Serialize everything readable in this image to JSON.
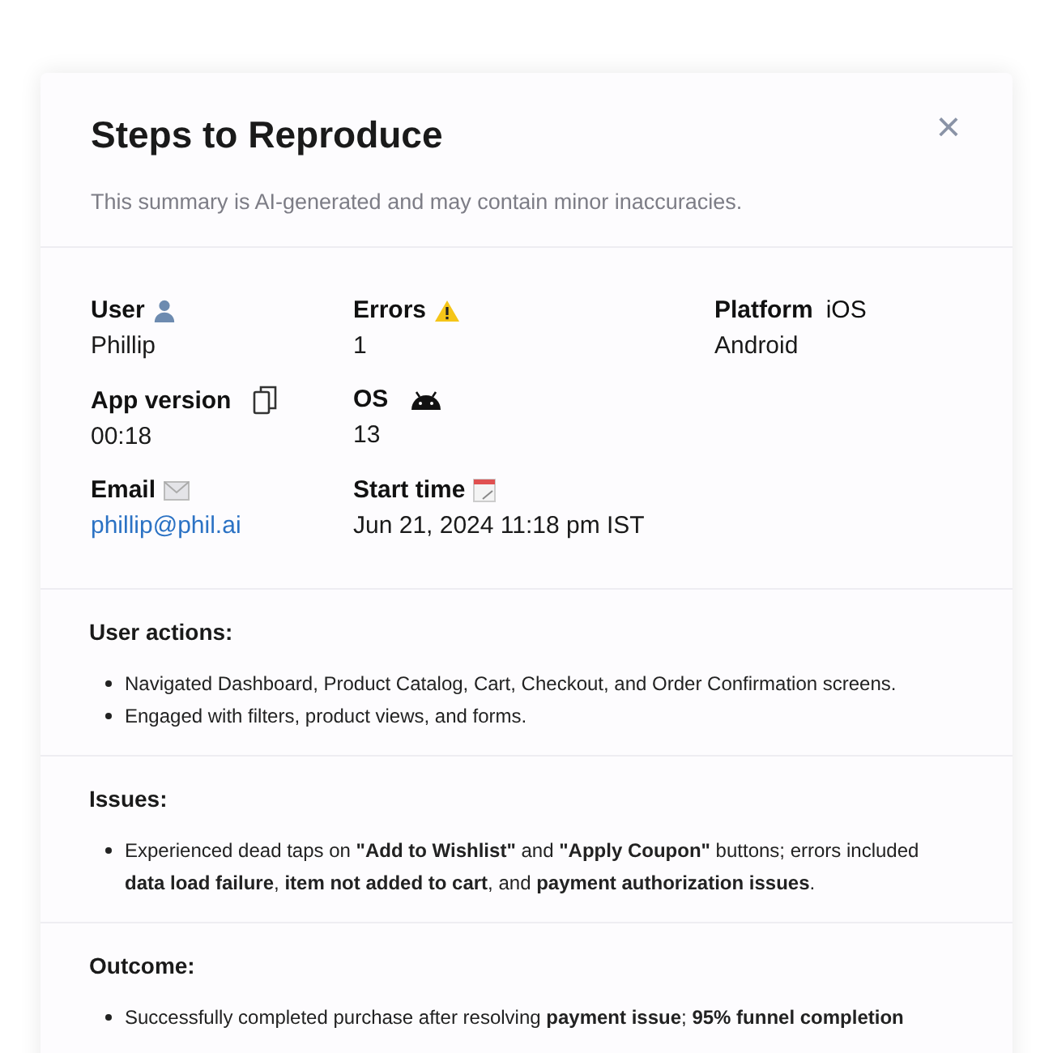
{
  "dialog": {
    "title": "Steps to Reproduce",
    "subtitle": "This summary is AI-generated and may contain minor inaccuracies.",
    "close": "×"
  },
  "field_rows": [
    [
      {
        "label": "User",
        "value": "Phillip",
        "link": false
      },
      {
        "label": "Errors",
        "value": "1",
        "link": false
      },
      {
        "label": "Platform",
        "tag": "iOS",
        "value": "Android",
        "link": false
      }
    ],
    [
      {
        "label": "App version",
        "value": "00:18",
        "link": false
      },
      {
        "label": "OS",
        "value": "13",
        "link": false
      }
    ],
    [
      {
        "label": "Email",
        "value": "phillip@phil.ai",
        "link": true
      },
      {
        "label": "Start time",
        "value": "Jun 21, 2024 11:18 pm IST",
        "link": false
      }
    ]
  ],
  "sections": [
    {
      "heading": "User actions:",
      "bullets": [
        "Navigated Dashboard, Product Catalog, Cart, Checkout, and Order Confirmation screens.",
        "Engaged with filters, product views, and forms."
      ]
    },
    {
      "heading": "Issues:",
      "bullets": [
        "Experienced dead taps on **\"Add to Wishlist\"** and **\"Apply Coupon\"** buttons; errors included **data load failure**, **item not added to cart**, and **payment authorization issues**."
      ]
    },
    {
      "heading": "Outcome:",
      "bullets": [
        "Successfully completed purchase after resolving **payment issue**; **95% funnel completion**"
      ]
    }
  ]
}
